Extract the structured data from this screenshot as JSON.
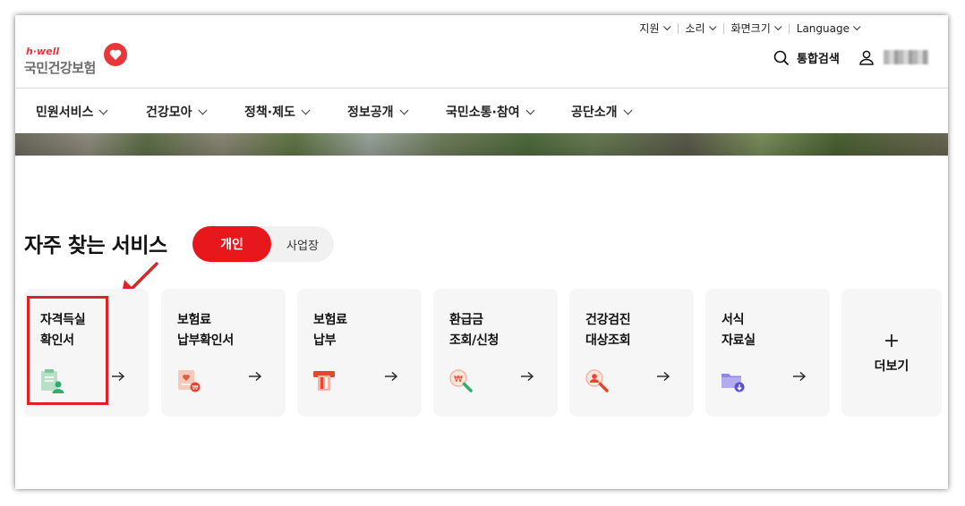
{
  "utility": {
    "items": [
      {
        "label": "지원"
      },
      {
        "label": "소리"
      },
      {
        "label": "화면크기"
      },
      {
        "label": "Language"
      }
    ]
  },
  "logo": {
    "brand_en": "h·well",
    "brand_ko": "국민건강보험"
  },
  "header": {
    "search_label": "통합검색"
  },
  "gnb": {
    "items": [
      {
        "label": "민원서비스"
      },
      {
        "label": "건강모아"
      },
      {
        "label": "정책·제도"
      },
      {
        "label": "정보공개"
      },
      {
        "label": "국민소통·참여"
      },
      {
        "label": "공단소개"
      }
    ]
  },
  "section": {
    "title": "자주 찾는 서비스",
    "toggle": {
      "active": "개인",
      "inactive": "사업장"
    }
  },
  "cards": [
    {
      "title": "자격득실\n확인서",
      "icon": "certificate-person-icon"
    },
    {
      "title": "보험료\n납부확인서",
      "icon": "payment-receipt-icon"
    },
    {
      "title": "보험료\n납부",
      "icon": "card-payment-icon"
    },
    {
      "title": "환급금\n조회/신청",
      "icon": "refund-search-icon"
    },
    {
      "title": "건강검진\n대상조회",
      "icon": "checkup-search-icon"
    },
    {
      "title": "서식\n자료실",
      "icon": "folder-download-icon"
    }
  ],
  "more": {
    "label": "더보기",
    "symbol": "+"
  },
  "colors": {
    "accent": "#e8171c",
    "annotation": "#e02228"
  }
}
